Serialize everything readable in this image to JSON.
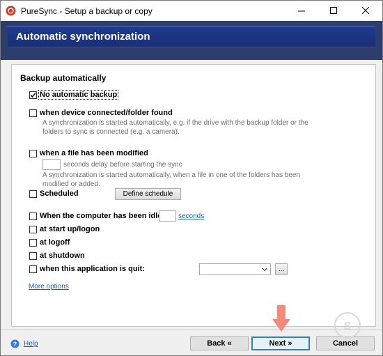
{
  "window": {
    "title": "PureSync - Setup a backup or copy"
  },
  "header": {
    "title": "Automatic synchronization"
  },
  "section": {
    "heading": "Backup automatically"
  },
  "options": {
    "no_backup": {
      "label": "No automatic backup",
      "checked": true
    },
    "device": {
      "label": "when device connected/folder found",
      "desc_line1": "A synchronization is started automatically, e.g. if the drive with the backup folder or the",
      "desc_line2": "folders to sync is connected (e.g. a camera).",
      "checked": false
    },
    "file_modified": {
      "label": "when a file has been modified",
      "delay_value": "",
      "delay_suffix": "seconds delay before starting the sync",
      "desc_line1": "A synchronization is started automatically, when a file in one of the folders has been",
      "desc_line2": "modified or added.",
      "checked": false
    },
    "scheduled": {
      "label": "Scheduled",
      "button": "Define schedule",
      "checked": false
    },
    "idle": {
      "label": "When the computer has been idle for",
      "value": "",
      "link": "seconds",
      "checked": false
    },
    "startup": {
      "label": "at start up/logon",
      "checked": false
    },
    "logoff": {
      "label": "at logoff",
      "checked": false
    },
    "shutdown": {
      "label": "at shutdown",
      "checked": false
    },
    "app_quit": {
      "label": "when this application is quit:",
      "select_value": "",
      "browse": "...",
      "checked": false
    }
  },
  "more_options": "More options",
  "footer": {
    "help": "Help",
    "back": "Back «",
    "next": "Next »",
    "cancel": "Cancel"
  },
  "colors": {
    "header_blue": "#1f3b8f",
    "band": "#2d3e6e",
    "link": "#1a5fb4",
    "arrow": "#f08a7a",
    "next_border": "#3c7fb1"
  }
}
